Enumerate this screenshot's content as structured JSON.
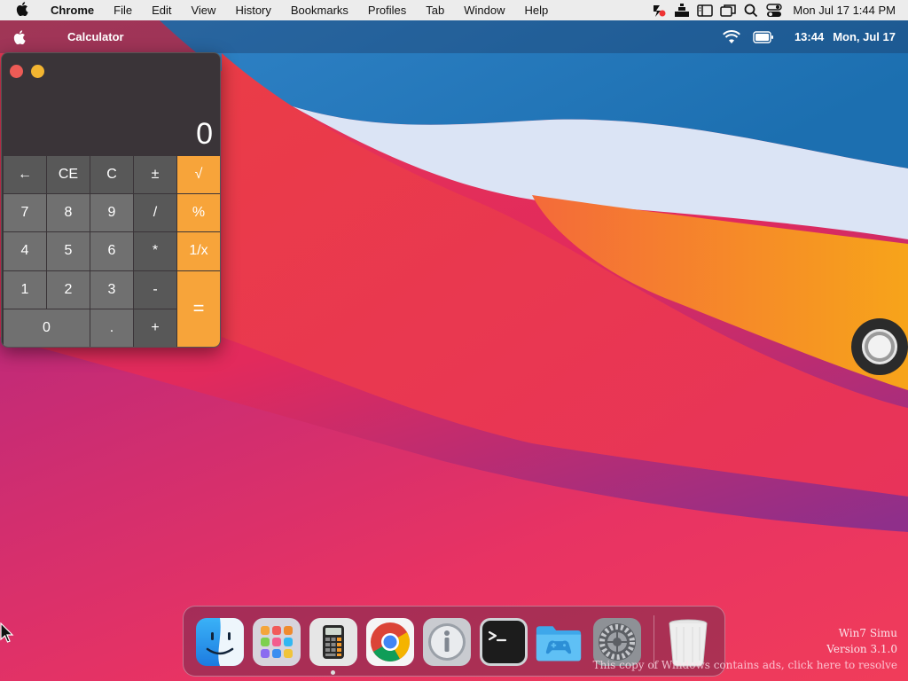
{
  "host_menubar": {
    "app_name": "Chrome",
    "menus": [
      "File",
      "Edit",
      "View",
      "History",
      "Bookmarks",
      "Profiles",
      "Tab",
      "Window",
      "Help"
    ],
    "clock": "Mon Jul 17  1:44 PM"
  },
  "sim_menubar": {
    "app_name": "Calculator",
    "time": "13:44",
    "date": "Mon, Jul 17"
  },
  "calculator": {
    "display": "0",
    "keys": {
      "backspace": "←",
      "ce": "CE",
      "c": "C",
      "plusminus": "±",
      "sqrt": "√",
      "k7": "7",
      "k8": "8",
      "k9": "9",
      "divide": "/",
      "percent": "%",
      "k4": "4",
      "k5": "5",
      "k6": "6",
      "multiply": "*",
      "reciprocal": "1/x",
      "k1": "1",
      "k2": "2",
      "k3": "3",
      "minus": "-",
      "equals": "=",
      "k0": "0",
      "decimal": ".",
      "plus": "+"
    }
  },
  "dock": {
    "items": [
      "finder",
      "launchpad",
      "calculator",
      "chrome",
      "about",
      "terminal",
      "games-folder",
      "system-preferences",
      "trash"
    ]
  },
  "watermark": {
    "title": "Win7 Simu",
    "version": "Version 3.1.0",
    "notice": "This copy of Windows contains ads, click here to resolve"
  },
  "colors": {
    "accent_orange": "#f7a43a",
    "close_red": "#ed5b56",
    "minimize_yellow": "#f3b531"
  }
}
